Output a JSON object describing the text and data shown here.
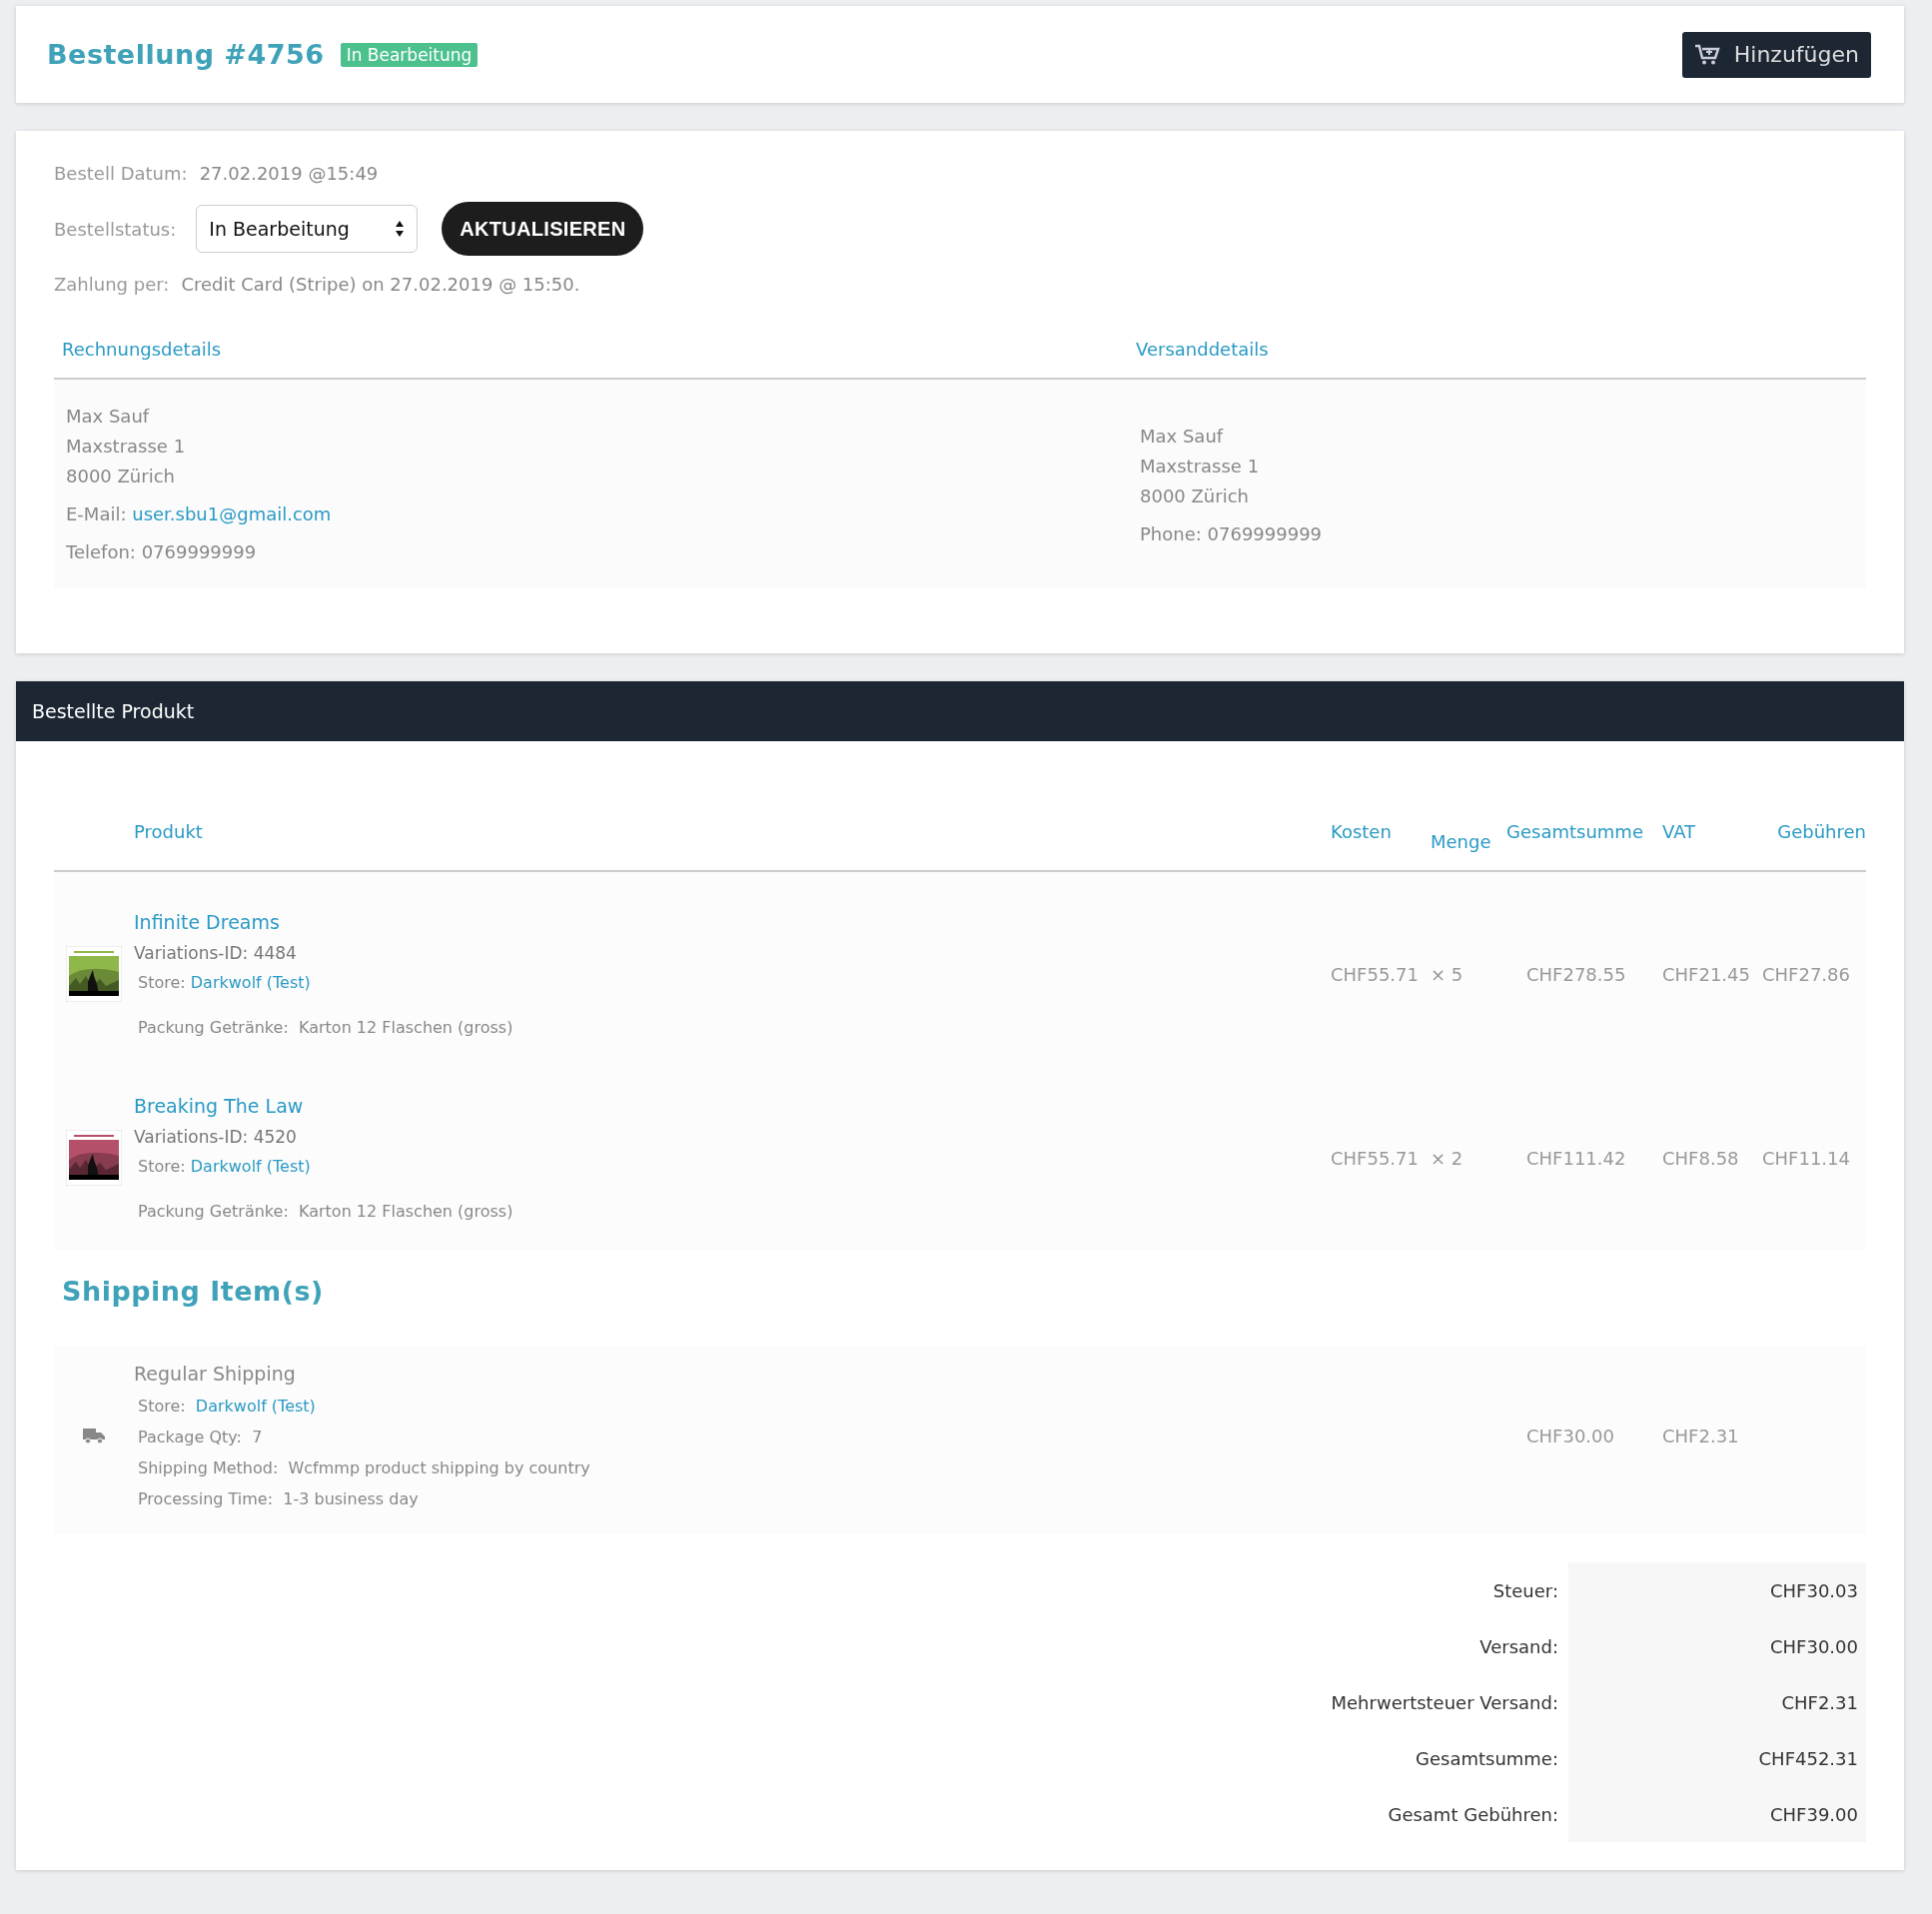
{
  "header": {
    "title": "Bestellung #4756",
    "status_badge": "In Bearbeitung",
    "add_button": "Hinzufügen"
  },
  "order": {
    "date_label": "Bestell Datum:",
    "date": "27.02.2019 @15:49",
    "status_label": "Bestellstatus:",
    "status_value": "In Bearbeitung",
    "update_button": "AKTUALISIEREN",
    "payment_label": "Zahlung per:",
    "payment": "Credit Card (Stripe) on 27.02.2019 @ 15:50."
  },
  "billing": {
    "heading": "Rechnungsdetails",
    "lines": [
      "Max Sauf",
      "Maxstrasse 1",
      "8000 Zürich"
    ],
    "email_label": "E-Mail:",
    "email": "user.sbu1@gmail.com",
    "phone_label": "Telefon:",
    "phone": "0769999999"
  },
  "shipping_address": {
    "heading": "Versanddetails",
    "lines": [
      "Max Sauf",
      "Maxstrasse 1",
      "8000 Zürich"
    ],
    "phone_label": "Phone:",
    "phone": "0769999999"
  },
  "products_panel": {
    "title": "Bestellte Produkt",
    "columns": [
      "Produkt",
      "Kosten",
      "Menge",
      "Gesamtsumme",
      "VAT",
      "Gebühren"
    ],
    "rows": [
      {
        "name": "Infinite Dreams",
        "variation": "Variations-ID: 4484",
        "store_label": "Store:",
        "store": "Darkwolf (Test)",
        "meta_label": "Packung Getränke:",
        "meta_value": "Karton 12 Flaschen (gross)",
        "cost": "CHF55.71",
        "qty": "× 5",
        "total": "CHF278.55",
        "vat": "CHF21.45",
        "fees": "CHF27.86"
      },
      {
        "name": "Breaking The Law",
        "variation": "Variations-ID: 4520",
        "store_label": "Store:",
        "store": "Darkwolf (Test)",
        "meta_label": "Packung Getränke:",
        "meta_value": "Karton 12 Flaschen (gross)",
        "cost": "CHF55.71",
        "qty": "× 2",
        "total": "CHF111.42",
        "vat": "CHF8.58",
        "fees": "CHF11.14"
      }
    ],
    "shipping_heading": "Shipping Item(s)",
    "shipping_item": {
      "name": "Regular Shipping",
      "details": [
        {
          "label": "Store:",
          "value": "Darkwolf (Test)",
          "kind": "link"
        },
        {
          "label": "Package Qty:",
          "value": "7",
          "kind": "text"
        },
        {
          "label": "Shipping Method:",
          "value": "Wcfmmp product shipping by country",
          "kind": "text"
        },
        {
          "label": "Processing Time:",
          "value": "1-3 business day",
          "kind": "text"
        }
      ],
      "total": "CHF30.00",
      "vat": "CHF2.31"
    },
    "totals": [
      {
        "label": "Steuer:",
        "value": "CHF30.03"
      },
      {
        "label": "Versand:",
        "value": "CHF30.00"
      },
      {
        "label": "Mehrwertsteuer Versand:",
        "value": "CHF2.31"
      },
      {
        "label": "Gesamtsumme:",
        "value": "CHF452.31"
      },
      {
        "label": "Gesamt Gebühren:",
        "value": "CHF39.00"
      }
    ]
  }
}
